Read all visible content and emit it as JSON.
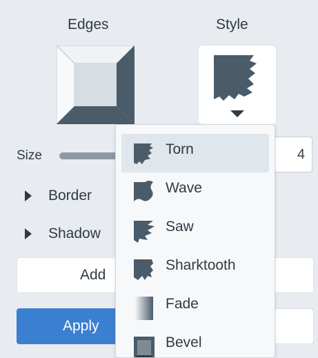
{
  "panel": {
    "edges_heading": "Edges",
    "style_heading": "Style",
    "size_label": "Size",
    "size_value": "4",
    "size_slider_fraction": 0.85,
    "border_label": "Border",
    "shadow_label": "Shadow",
    "add_button_label": "Add",
    "apply_button_label": "Apply"
  },
  "style_dropdown": {
    "items": [
      {
        "label": "Torn",
        "icon": "torn-edge-icon",
        "selected": true
      },
      {
        "label": "Wave",
        "icon": "wave-edge-icon"
      },
      {
        "label": "Saw",
        "icon": "saw-edge-icon"
      },
      {
        "label": "Sharktooth",
        "icon": "sharktooth-edge-icon"
      },
      {
        "label": "Fade",
        "icon": "fade-edge-icon"
      },
      {
        "label": "Bevel",
        "icon": "bevel-edge-icon"
      }
    ]
  },
  "colors": {
    "accent": "#3b7fd0",
    "icon_slate": "#4a5b69",
    "panel_bg": "#e8ecf0",
    "selected_bg": "#dfe6ec"
  }
}
